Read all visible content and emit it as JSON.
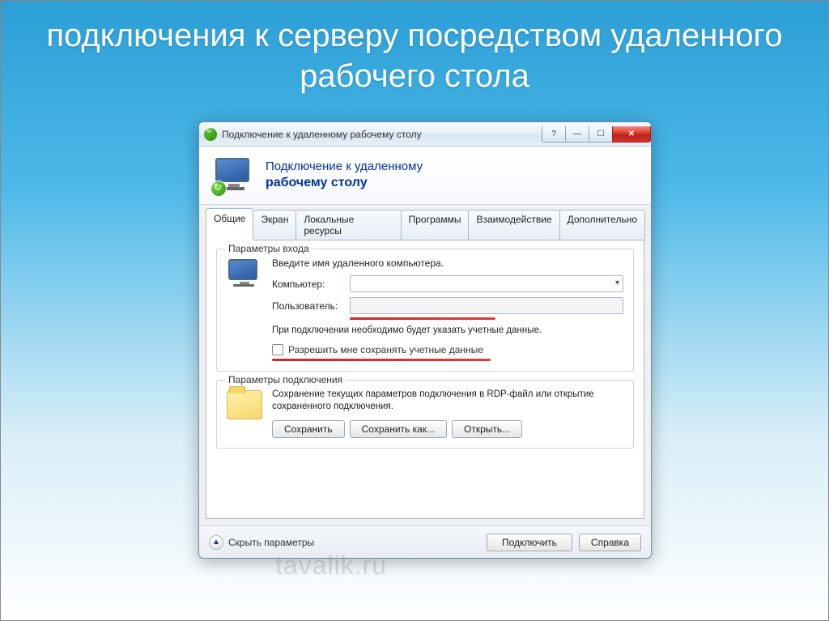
{
  "slide": {
    "title": "подключения к серверу посредством удаленного рабочего стола"
  },
  "window": {
    "title": "Подключение к удаленному рабочему столу",
    "banner_line1": "Подключение к удаленному",
    "banner_line2": "рабочему столу"
  },
  "tabs": [
    {
      "label": "Общие",
      "active": true
    },
    {
      "label": "Экран",
      "active": false
    },
    {
      "label": "Локальные ресурсы",
      "active": false
    },
    {
      "label": "Программы",
      "active": false
    },
    {
      "label": "Взаимодействие",
      "active": false
    },
    {
      "label": "Дополнительно",
      "active": false
    }
  ],
  "login": {
    "legend": "Параметры входа",
    "hint": "Введите имя удаленного компьютера.",
    "computer_label": "Компьютер:",
    "computer_value": "",
    "user_label": "Пользователь:",
    "user_value": "",
    "note": "При подключении необходимо будет указать учетные данные.",
    "save_creds": "Разрешить мне сохранять учетные данные"
  },
  "conn": {
    "legend": "Параметры подключения",
    "text": "Сохранение текущих параметров подключения в RDP-файл или открытие сохраненного подключения.",
    "save": "Сохранить",
    "save_as": "Сохранить как...",
    "open": "Открыть..."
  },
  "footer": {
    "collapse": "Скрыть параметры",
    "connect": "Подключить",
    "help": "Справка"
  },
  "watermark": "tavalik.ru"
}
